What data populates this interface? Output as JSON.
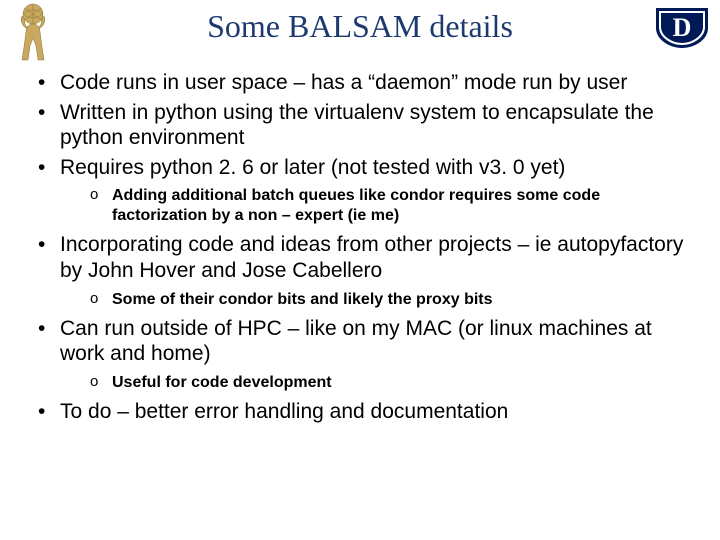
{
  "title": "Some BALSAM details",
  "bullets": {
    "b1": "Code runs in user space – has a “daemon” mode run by user",
    "b2": "Written in python using the virtualenv system to encapsulate the python environment",
    "b3": "Requires python 2. 6 or later (not tested with v3. 0 yet)",
    "b3s1": "Adding additional batch queues  like condor requires some code factorization by a non – expert (ie me)",
    "b4": "Incorporating code and ideas from other projects – ie autopyfactory  by John Hover and Jose Cabellero",
    "b4s1": "Some of their condor bits and likely the proxy bits",
    "b5": "Can run outside of HPC – like on my MAC (or linux machines at work and home)",
    "b5s1": "Useful for code development",
    "b6": "To do – better error handling and documentation"
  },
  "logos": {
    "left": "atlas-figure-icon",
    "right": "duke-shield-icon",
    "right_letter": "D"
  }
}
